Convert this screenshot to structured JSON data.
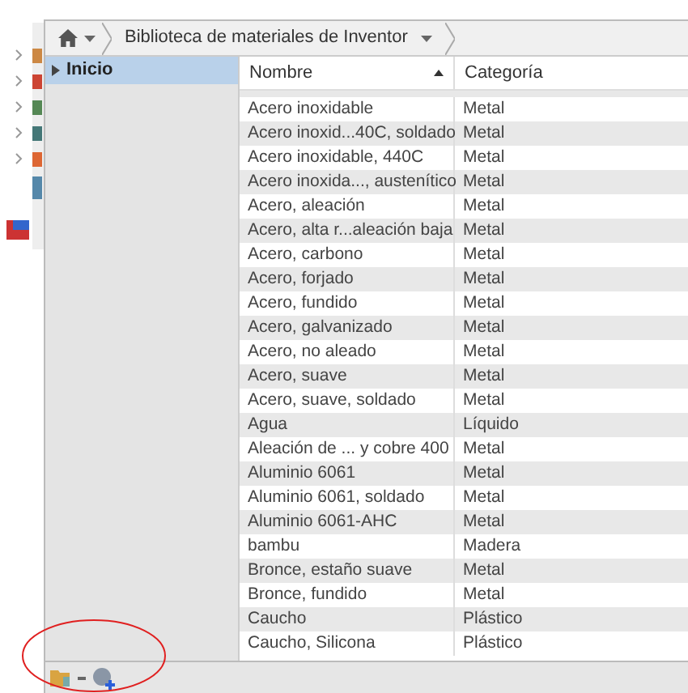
{
  "breadcrumb": {
    "items": [
      {
        "kind": "home"
      },
      {
        "kind": "text",
        "label": "Biblioteca de materiales de Inventor"
      }
    ]
  },
  "sidebar": {
    "items": [
      {
        "label": "Inicio",
        "selected": true
      }
    ]
  },
  "table": {
    "columns": [
      {
        "label": "Nombre",
        "sorted": true
      },
      {
        "label": "Categoría",
        "sorted": false
      }
    ],
    "rows": [
      [
        "Acero inoxidable",
        "Metal"
      ],
      [
        "Acero inoxid...40C, soldado",
        "Metal"
      ],
      [
        "Acero inoxidable, 440C",
        "Metal"
      ],
      [
        "Acero inoxida..., austenítico",
        "Metal"
      ],
      [
        "Acero, aleación",
        "Metal"
      ],
      [
        "Acero, alta r...aleación baja",
        "Metal"
      ],
      [
        "Acero, carbono",
        "Metal"
      ],
      [
        "Acero, forjado",
        "Metal"
      ],
      [
        "Acero, fundido",
        "Metal"
      ],
      [
        "Acero, galvanizado",
        "Metal"
      ],
      [
        "Acero, no aleado",
        "Metal"
      ],
      [
        "Acero, suave",
        "Metal"
      ],
      [
        "Acero, suave, soldado",
        "Metal"
      ],
      [
        "Agua",
        "Líquido"
      ],
      [
        "Aleación de ... y cobre 400",
        "Metal"
      ],
      [
        "Aluminio 6061",
        "Metal"
      ],
      [
        "Aluminio 6061, soldado",
        "Metal"
      ],
      [
        "Aluminio 6061-AHC",
        "Metal"
      ],
      [
        "bambu",
        "Madera"
      ],
      [
        "Bronce, estaño suave",
        "Metal"
      ],
      [
        "Bronce, fundido",
        "Metal"
      ],
      [
        "Caucho",
        "Plástico"
      ],
      [
        "Caucho, Silicona",
        "Plástico"
      ]
    ]
  }
}
